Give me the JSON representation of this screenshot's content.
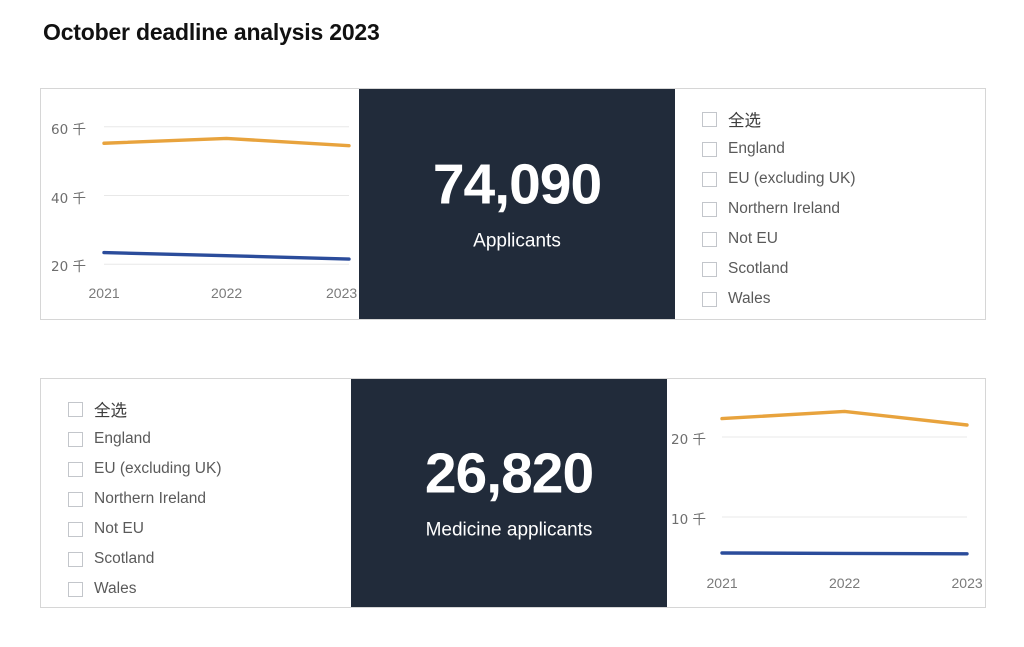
{
  "page": {
    "title": "October deadline analysis 2023",
    "background": "#ffffff"
  },
  "colors": {
    "series_all": "#e8a33d",
    "series_medicine": "#2b4c9b",
    "kpi_background": "#212b3a",
    "kpi_text": "#ffffff",
    "grid": "#e8e8e8",
    "card_border": "#d6d6d6",
    "axis_text": "#7a7a7a",
    "legend_text": "#5a5a5a",
    "checkbox_border": "#c3c6cb"
  },
  "top_card": {
    "kpi": {
      "value": "74,090",
      "label": "Applicants"
    },
    "legend": {
      "items": [
        {
          "label": "全选",
          "checked": false,
          "cjk": true
        },
        {
          "label": "England",
          "checked": false,
          "cjk": false
        },
        {
          "label": "EU (excluding UK)",
          "checked": false,
          "cjk": false
        },
        {
          "label": "Northern Ireland",
          "checked": false,
          "cjk": false
        },
        {
          "label": "Not EU",
          "checked": false,
          "cjk": false
        },
        {
          "label": "Scotland",
          "checked": false,
          "cjk": false
        },
        {
          "label": "Wales",
          "checked": false,
          "cjk": false
        }
      ]
    }
  },
  "bottom_card": {
    "kpi": {
      "value": "26,820",
      "label": "Medicine applicants"
    },
    "legend": {
      "items": [
        {
          "label": "全选",
          "checked": false,
          "cjk": true
        },
        {
          "label": "England",
          "checked": false,
          "cjk": false
        },
        {
          "label": "EU (excluding UK)",
          "checked": false,
          "cjk": false
        },
        {
          "label": "Northern Ireland",
          "checked": false,
          "cjk": false
        },
        {
          "label": "Not EU",
          "checked": false,
          "cjk": false
        },
        {
          "label": "Scotland",
          "checked": false,
          "cjk": false
        },
        {
          "label": "Wales",
          "checked": false,
          "cjk": false
        }
      ]
    }
  },
  "chart_data": [
    {
      "id": "top-chart",
      "type": "line",
      "title": "",
      "xlabel": "",
      "ylabel": "",
      "x": [
        "2021",
        "2022",
        "2023"
      ],
      "xticklabels": [
        "2021",
        "2022",
        "2023"
      ],
      "yticks": [
        20000,
        40000,
        60000
      ],
      "yticklabels": [
        "20 千",
        "40 千",
        "60 千"
      ],
      "ylim": [
        16000,
        64000
      ],
      "grid": true,
      "legend": "none",
      "series": [
        {
          "name": "Applicants",
          "color": "#e8a33d",
          "values": [
            55200,
            56600,
            54500
          ]
        },
        {
          "name": "Medicine applicants",
          "color": "#2b4c9b",
          "values": [
            23400,
            22500,
            21500
          ]
        }
      ]
    },
    {
      "id": "bottom-chart",
      "type": "line",
      "title": "",
      "xlabel": "",
      "ylabel": "",
      "x": [
        "2021",
        "2022",
        "2023"
      ],
      "xticklabels": [
        "2021",
        "2022",
        "2023"
      ],
      "yticks": [
        10000,
        20000
      ],
      "yticklabels": [
        "10 千",
        "20 千"
      ],
      "ylim": [
        4000,
        25500
      ],
      "grid": true,
      "legend": "none",
      "series": [
        {
          "name": "Applicants",
          "color": "#e8a33d",
          "values": [
            22300,
            23200,
            21500
          ]
        },
        {
          "name": "Medicine applicants",
          "color": "#2b4c9b",
          "values": [
            5500,
            5450,
            5400
          ]
        }
      ]
    }
  ]
}
